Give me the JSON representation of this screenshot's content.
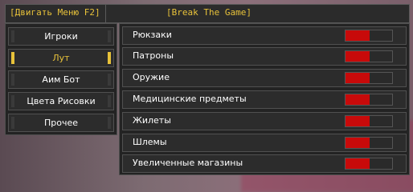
{
  "titlebar": {
    "left_text": "[Двигать Меню F2]",
    "right_text": "[Break The Game]"
  },
  "sidebar": {
    "items": [
      {
        "label": "Игроки",
        "active": false
      },
      {
        "label": "Лут",
        "active": true
      },
      {
        "label": "Аим Бот",
        "active": false
      },
      {
        "label": "Цвета Рисовки",
        "active": false
      },
      {
        "label": "Прочее",
        "active": false
      }
    ]
  },
  "options": [
    {
      "label": "Рюкзаки",
      "enabled": true
    },
    {
      "label": "Патроны",
      "enabled": true
    },
    {
      "label": "Оружие",
      "enabled": true
    },
    {
      "label": "Медицинские предметы",
      "enabled": true
    },
    {
      "label": "Жилеты",
      "enabled": true
    },
    {
      "label": "Шлемы",
      "enabled": true
    },
    {
      "label": "Увеличенные магазины",
      "enabled": true
    }
  ],
  "colors": {
    "accent": "#e8c23a",
    "toggle_on": "#c80a0a",
    "panel_bg": "#232323"
  }
}
